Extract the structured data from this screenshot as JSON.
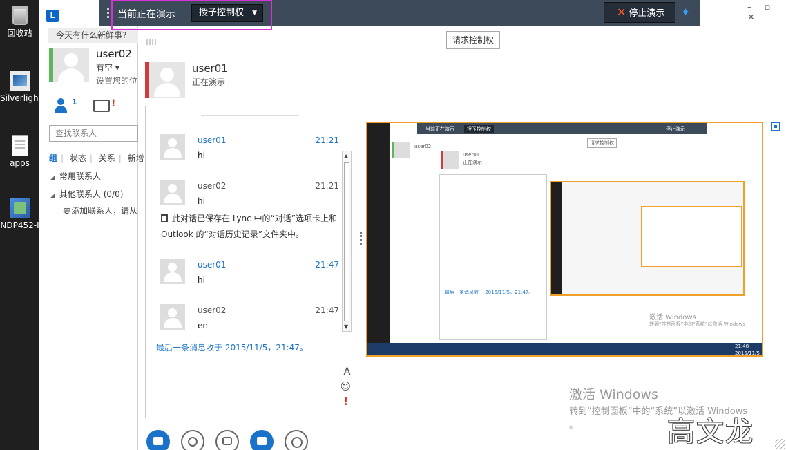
{
  "desktop": {
    "icons": [
      {
        "label": "回收站",
        "icon": "recycle-bin-icon"
      },
      {
        "label": "Silverlight",
        "icon": "silverlight-icon"
      },
      {
        "label": "apps",
        "icon": "folder-doc-icon"
      },
      {
        "label": "NDP452-I",
        "icon": "installer-icon"
      }
    ]
  },
  "lync": {
    "whats_new": "今天有什么新鲜事?",
    "user_name": "user02",
    "status": "有空 ▾",
    "note": "设置您的位",
    "contacts_count": "1",
    "chat_alert": "!",
    "search_placeholder": "查找联系人",
    "tabs": [
      "组",
      "状态",
      "关系",
      "新增"
    ],
    "groups": [
      "常用联系人",
      "其他联系人 (0/0)"
    ],
    "add_hint": "要添加联系人，请从"
  },
  "toolbar": {
    "presenting_label": "当前正在演示",
    "give_control_label": "授予控制权",
    "stop_label": "停止演示",
    "pin_icon": "pin-icon"
  },
  "window_controls": {
    "minimize": "–",
    "restore": "▫",
    "close": "✕"
  },
  "stage": {
    "request_control": "请求控制权"
  },
  "conversation": {
    "peer_name": "user01",
    "peer_status": "正在演示",
    "messages": [
      {
        "sender": "user01",
        "time": "21:21",
        "text": "hi"
      },
      {
        "sender": "user02",
        "time": "21:21",
        "text": "hi"
      },
      {
        "sender": "user01",
        "time": "21:47",
        "text": "hi"
      },
      {
        "sender": "user02",
        "time": "21:47",
        "text": "en"
      }
    ],
    "saved_note": "此对话已保存在 Lync 中的“对话”选项卡上和 Outlook 的“对话历史记录”文件夹中。",
    "last_message": "最后一条消息收于 2015/11/5，21:47。",
    "compose_font": "A",
    "compose_emoji": "☺",
    "compose_important": "!"
  },
  "watermark": {
    "title": "激活 Windows",
    "subtitle": "转到“控制面板”中的“系统”以激活 Windows",
    "dot": "。",
    "author": "高文龙"
  },
  "thumbnail": {
    "presenting": "当前正在演示",
    "give_control": "授予控制权",
    "stop": "停止演示",
    "request": "请求控制权",
    "peer": "user01",
    "peer_status": "正在演示",
    "user": "user02",
    "last_msg": "最后一条消息收于 2015/11/5，21:47。",
    "act_title": "激活 Windows",
    "act_sub": "转到“控制面板”中的“系统”以激活 Windows",
    "clock_time": "21:48",
    "clock_date": "2015/11/5"
  },
  "colors": {
    "accent": "#1a73c9",
    "toolbar": "#3c4a5a",
    "highlight": "#d632d6",
    "presence_green": "#5cb85c",
    "presence_red": "#d23b3b",
    "share_border": "#f0a02a"
  }
}
